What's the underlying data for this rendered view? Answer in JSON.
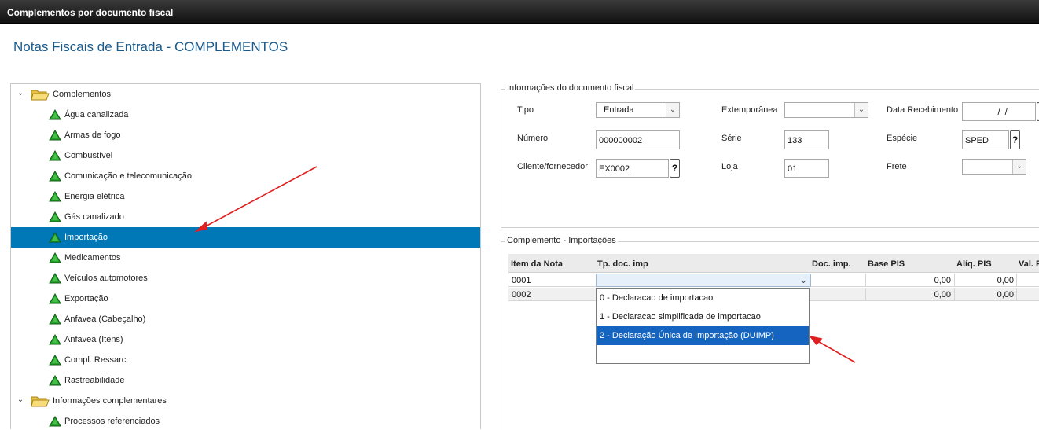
{
  "window": {
    "title": "Complementos por documento fiscal"
  },
  "page": {
    "title": "Notas Fiscais de Entrada - COMPLEMENTOS"
  },
  "tree": {
    "root1": {
      "label": "Complementos"
    },
    "children1": [
      "Água canalizada",
      "Armas de fogo",
      "Combustível",
      "Comunicação e telecomunicação",
      "Energia elétrica",
      "Gás canalizado",
      "Importação",
      "Medicamentos",
      "Veículos automotores",
      "Exportação",
      "Anfavea (Cabeçalho)",
      "Anfavea (Itens)",
      "Compl. Ressarc.",
      "Rastreabilidade"
    ],
    "selected_index": 6,
    "root2": {
      "label": "Informações complementares"
    },
    "children2": [
      "Processos referenciados"
    ],
    "colors": {
      "selected_bg": "#0078b8",
      "status_icon": "#22a32a",
      "folder": "#f3d56b"
    }
  },
  "doc_info": {
    "legend": "Informações do documento fiscal",
    "tipo_label": "Tipo",
    "tipo_value": "Entrada",
    "extemporanea_label": "Extemporânea",
    "extemporanea_value": "",
    "data_recebimento_label": "Data Recebimento",
    "data_recebimento_value": "  /  /",
    "numero_label": "Número",
    "numero_value": "000000002",
    "serie_label": "Série",
    "serie_value": "133",
    "especie_label": "Espécie",
    "especie_value": "SPED",
    "cliente_label": "Cliente/fornecedor",
    "cliente_value": "EX0002",
    "loja_label": "Loja",
    "loja_value": "01",
    "frete_label": "Frete",
    "frete_value": "",
    "lookup_glyph": "?"
  },
  "importacoes": {
    "legend": "Complemento - Importações",
    "columns": [
      "Item da Nota",
      "Tp. doc. imp",
      "Doc. imp.",
      "Base PIS",
      "Alíq. PIS",
      "Val. P"
    ],
    "rows": [
      {
        "item": "0001",
        "tp_doc": "",
        "doc_imp": "",
        "base_pis": "0,00",
        "aliq_pis": "0,00"
      },
      {
        "item": "0002",
        "tp_doc": "",
        "doc_imp": "",
        "base_pis": "0,00",
        "aliq_pis": "0,00"
      }
    ],
    "dropdown_options": [
      "0 - Declaracao de importacao",
      "1 - Declaracao simplificada de importacao",
      "2 - Declaração Única de Importação (DUIMP)"
    ],
    "dropdown_selected_index": 2,
    "colors": {
      "dropdown_selected": "#1565c0",
      "annotation_arrow": "#e02020"
    }
  }
}
